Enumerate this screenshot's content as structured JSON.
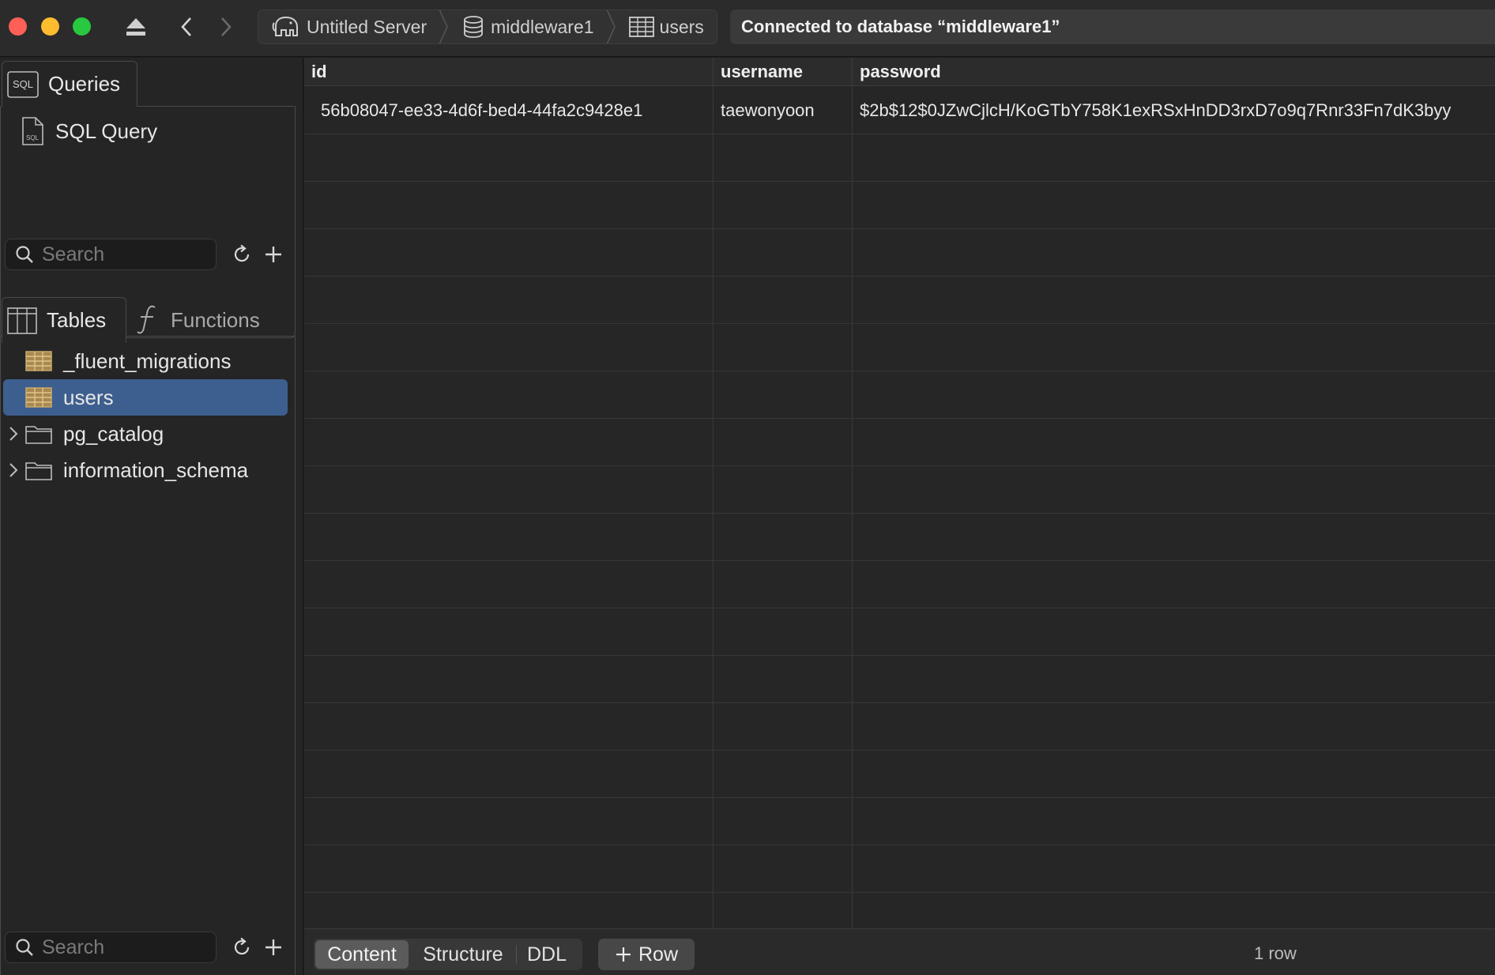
{
  "toolbar": {
    "breadcrumbs": [
      {
        "label": "Untitled Server",
        "icon": "elephant-icon"
      },
      {
        "label": "middleware1",
        "icon": "database-icon"
      },
      {
        "label": "users",
        "icon": "table-icon"
      }
    ],
    "status": "Connected to database “middleware1”"
  },
  "sidebar": {
    "queries_tab": "Queries",
    "query_item": "SQL Query",
    "search_placeholder": "Search",
    "tables_tab": "Tables",
    "functions_tab": "Functions",
    "tree": [
      {
        "label": "_fluent_migrations",
        "type": "table",
        "selected": false
      },
      {
        "label": "users",
        "type": "table",
        "selected": true
      },
      {
        "label": "pg_catalog",
        "type": "folder",
        "selected": false
      },
      {
        "label": "information_schema",
        "type": "folder",
        "selected": false
      }
    ],
    "bottom_search_placeholder": "Search"
  },
  "table": {
    "columns": [
      "id",
      "username",
      "password"
    ],
    "rows": [
      [
        "56b08047-ee33-4d6f-bed4-44fa2c9428e1",
        "taewonyoon",
        "$2b$12$0JZwCjlcH/KoGTbY758K1exRSxHnDD3rxD7o9q7Rnr33Fn7dK3byy"
      ]
    ]
  },
  "bottom": {
    "tabs": [
      "Content",
      "Structure",
      "DDL"
    ],
    "active_tab": "Content",
    "add_row": "Row",
    "row_count": "1 row"
  },
  "colors": {
    "selection": "#3d5f8f",
    "close": "#fe5f57",
    "minimize": "#febc2e",
    "maximize": "#28c840",
    "table_icon": "#c8a96a"
  }
}
